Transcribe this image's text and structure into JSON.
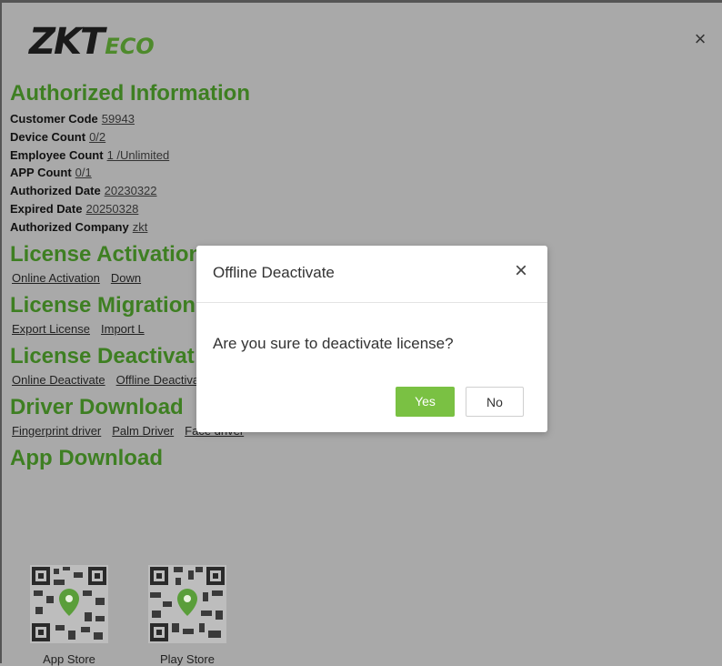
{
  "header": {
    "logo_main": "ZKT",
    "logo_sub": "ECO",
    "close_glyph": "×"
  },
  "authorized": {
    "title": "Authorized Information",
    "fields": [
      {
        "label": "Customer Code",
        "value": "59943"
      },
      {
        "label": "Device Count",
        "value": "0/2"
      },
      {
        "label": "Employee Count",
        "value": "1 /Unlimited"
      },
      {
        "label": "APP Count",
        "value": "0/1"
      },
      {
        "label": "Authorized Date",
        "value": "20230322"
      },
      {
        "label": "Expired Date",
        "value": "20250328"
      },
      {
        "label": "Authorized Company",
        "value": "zkt"
      }
    ]
  },
  "activation": {
    "title": "License Activation",
    "links": [
      "Online Activation",
      "Down"
    ]
  },
  "migration": {
    "title": "License Migration",
    "links": [
      "Export License",
      "Import L"
    ]
  },
  "deactivation": {
    "title": "License Deactivat",
    "links": [
      "Online Deactivate",
      "Offline Deactivate"
    ]
  },
  "driver": {
    "title": "Driver Download",
    "links": [
      "Fingerprint driver",
      "Palm Driver",
      "Face driver"
    ]
  },
  "app": {
    "title": "App Download",
    "items": [
      {
        "label": "App Store",
        "icon": "qr-code-icon"
      },
      {
        "label": "Play Store",
        "icon": "qr-code-icon"
      }
    ]
  },
  "dialog": {
    "title": "Offline Deactivate",
    "close_glyph": "×",
    "message": "Are you sure to deactivate license?",
    "yes_label": "Yes",
    "no_label": "No"
  },
  "colors": {
    "accent_green": "#3e7f22",
    "button_green": "#7ac143",
    "overlay_gray": "#a9a9a9"
  }
}
